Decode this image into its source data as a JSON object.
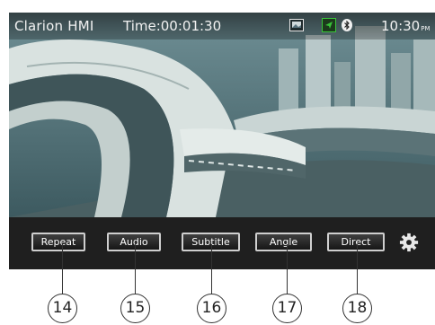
{
  "status_bar": {
    "app_title": "Clarion HMI",
    "time_label": "Time:00:01:30",
    "clock": "10:30",
    "clock_ampm": "PM",
    "icons": [
      "photo-icon",
      "navigation-icon",
      "bluetooth-icon"
    ],
    "nav_icon_color": "#39c43a"
  },
  "controls": {
    "buttons": [
      "Repeat",
      "Audio",
      "Subtitle",
      "Angle",
      "Direct"
    ],
    "settings_icon": "gear-icon"
  },
  "callouts": [
    "14",
    "15",
    "16",
    "17",
    "18"
  ]
}
